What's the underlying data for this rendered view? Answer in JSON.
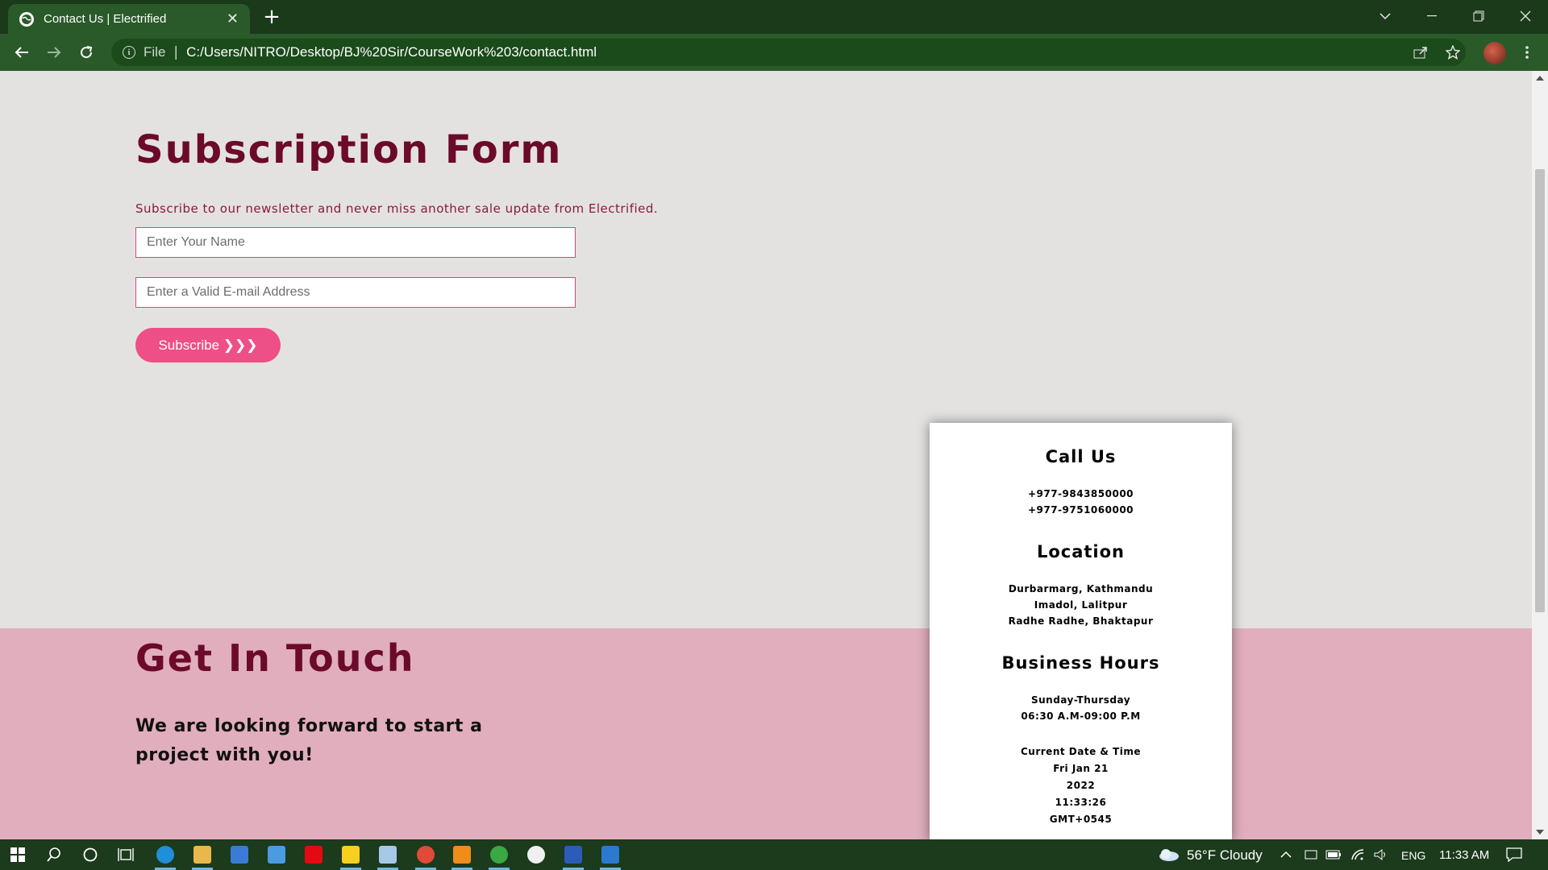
{
  "browser": {
    "tab_title": "Contact Us | Electrified",
    "new_tab_symbol": "+",
    "scheme_label": "File",
    "url": "C:/Users/NITRO/Desktop/BJ%20Sir/CourseWork%203/contact.html"
  },
  "subscription": {
    "title": "Subscription Form",
    "description": "Subscribe to our newsletter and never miss another sale update from Electrified.",
    "name_placeholder": "Enter Your Name",
    "email_placeholder": "Enter a Valid E-mail Address",
    "button_label": "Subscribe ❯❯❯"
  },
  "get_in_touch": {
    "title": "Get In Touch",
    "text": "We are looking forward to start a project with you!"
  },
  "contact_card": {
    "call_title": "Call Us",
    "phones": [
      "+977-9843850000",
      "+977-9751060000"
    ],
    "location_title": "Location",
    "locations": [
      "Durbarmarg, Kathmandu",
      "Imadol, Lalitpur",
      "Radhe Radhe, Bhaktapur"
    ],
    "hours_title": "Business Hours",
    "days": "Sunday-Thursday",
    "hours": "06:30 A.M-09:00 P.M",
    "datetime_label": "Current Date & Time",
    "datetime_lines": [
      "Fri Jan 21",
      "2022",
      "11:33:26",
      "GMT+0545"
    ]
  },
  "taskbar": {
    "weather": "56°F  Cloudy",
    "language": "ENG",
    "time": "11:33 AM"
  },
  "colors": {
    "brand_dark": "#6b0a2a",
    "accent_pink": "#ee4f86",
    "band_pink": "#e1aebd",
    "chrome_green": "#2a5a2a"
  }
}
